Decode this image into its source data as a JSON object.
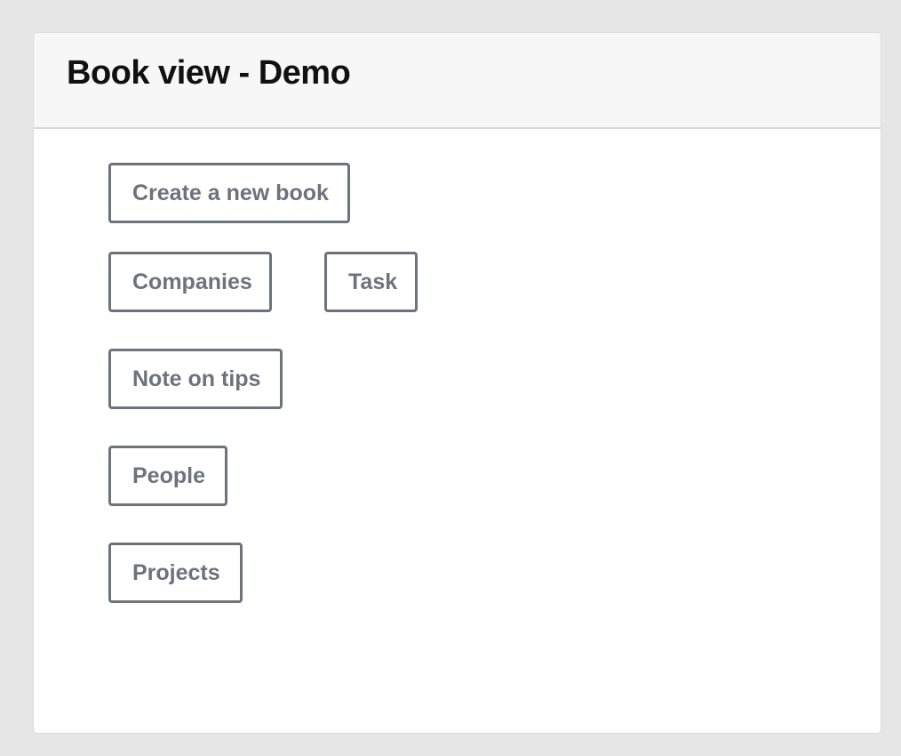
{
  "header": {
    "title": "Book view - Demo"
  },
  "actions": {
    "create_label": "Create a new book",
    "companies_label": "Companies",
    "task_label": "Task",
    "note_label": "Note on tips",
    "people_label": "People",
    "projects_label": "Projects"
  },
  "colors": {
    "background": "#e6e6e6",
    "header_bg": "#f7f7f7",
    "button_border": "#6c737b",
    "button_text": "#6c737b",
    "title_text": "#111111"
  }
}
